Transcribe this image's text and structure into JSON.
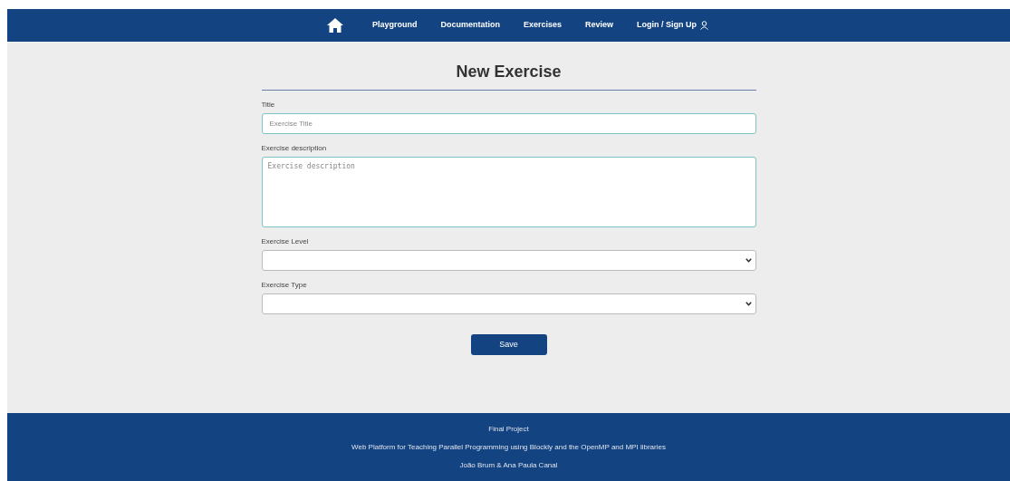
{
  "nav": {
    "items": [
      {
        "kind": "home"
      },
      {
        "kind": "link",
        "label": "Playground"
      },
      {
        "kind": "link",
        "label": "Documentation"
      },
      {
        "kind": "link",
        "label": "Exercises"
      },
      {
        "kind": "link",
        "label": "Review"
      },
      {
        "kind": "account",
        "label": "Login / Sign Up"
      }
    ]
  },
  "form": {
    "title": "New Exercise",
    "fields": [
      {
        "kind": "input",
        "label": "Title",
        "placeholder": "Exercise Title"
      },
      {
        "kind": "textarea",
        "label": "Exercise description",
        "placeholder": "Exercise description"
      },
      {
        "kind": "select",
        "label": "Exercise Level"
      },
      {
        "kind": "select",
        "label": "Exercise Type"
      }
    ],
    "button": "Save"
  },
  "footer": [
    "Final Project",
    "Web Platform for Teaching Parallel Programming using Blockly and the OpenMP and MPI libraries",
    "João Brum & Ana Paula Canal"
  ]
}
